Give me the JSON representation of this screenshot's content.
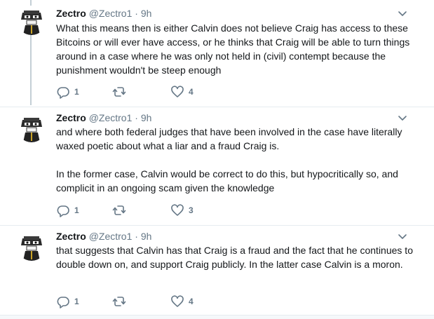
{
  "tweets": [
    {
      "name": "Zectro",
      "handle": "@Zectro1",
      "dot": "·",
      "time": "9h",
      "paragraphs": [
        "What this means then is either Calvin does not believe Craig has access to these Bitcoins or will ever have access, or he thinks that Craig will be able to turn things around in a case where he was only not held in (civil) contempt because the punishment wouldn't be steep enough"
      ],
      "replies": "1",
      "retweets": "",
      "likes": "4"
    },
    {
      "name": "Zectro",
      "handle": "@Zectro1",
      "dot": "·",
      "time": "9h",
      "paragraphs": [
        "and where both federal judges that have been involved in the case have literally waxed poetic about what a liar and a fraud Craig is.",
        "In the former case, Calvin would be correct to do this, but hypocritically so, and complicit in an ongoing scam given the knowledge"
      ],
      "replies": "1",
      "retweets": "",
      "likes": "3"
    },
    {
      "name": "Zectro",
      "handle": "@Zectro1",
      "dot": "·",
      "time": "9h",
      "paragraphs": [
        "that suggests that Calvin has that Craig is a fraud and the fact that he continues to double down on, and support Craig publicly. In the latter case Calvin is a moron."
      ],
      "replies": "1",
      "retweets": "",
      "likes": "4"
    }
  ],
  "icons": {
    "reply": "reply-icon",
    "retweet": "retweet-icon",
    "like": "heart-icon",
    "more": "chevron-down-icon",
    "avatar": "avatar"
  },
  "colors": {
    "name": "#14171a",
    "secondary": "#657786",
    "thread_line": "#c4cfd6",
    "divider": "#e6ecf0"
  }
}
